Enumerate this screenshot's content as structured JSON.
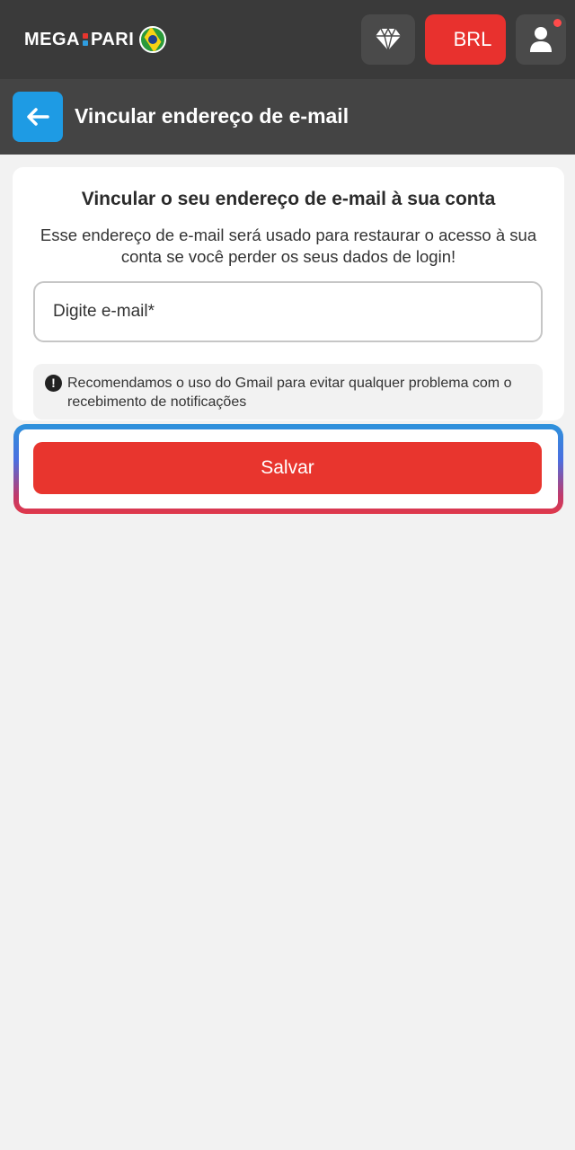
{
  "header": {
    "logo_left": "MEGA",
    "logo_right": "PARI",
    "currency_label": "BRL",
    "colors": {
      "bar": "#3a3a3a",
      "currency": "#e8312e",
      "notification": "#ff4b4b"
    },
    "icons": {
      "diamond": "diamond-icon",
      "user": "user-icon",
      "flag": "brazil-flag-icon"
    }
  },
  "subheader": {
    "title": "Vincular endereço de e-mail",
    "back_icon": "arrow-left-icon",
    "back_color": "#1e9be4"
  },
  "form": {
    "title": "Vincular o seu endereço de e-mail à sua conta",
    "description": "Esse endereço de e-mail será usado para restaurar o acesso à sua conta se você perder os seus dados de login!",
    "email": {
      "placeholder": "Digite e-mail*",
      "value": ""
    },
    "notice": {
      "icon": "exclamation-circle-icon",
      "text": "Recomendamos o uso do Gmail para evitar qualquer problema com o recebimento de notificações"
    },
    "save_label": "Salvar",
    "save_color": "#e8352e"
  }
}
